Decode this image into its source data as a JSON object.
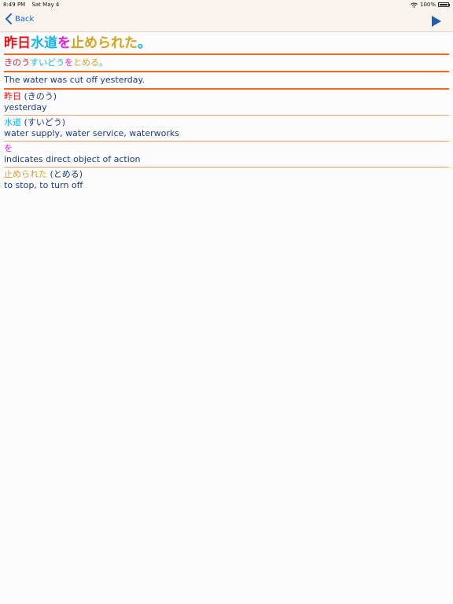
{
  "status_bar": {
    "time": "8:49 PM",
    "date": "Sat May 4",
    "battery": "100%"
  },
  "nav": {
    "back_label": "Back"
  },
  "colors": {
    "red": "#e8141c",
    "cyan": "#17b5e6",
    "magenta": "#e620e0",
    "gold": "#d6a21c",
    "blue": "#1a3b85",
    "orange": "#ef6a22"
  },
  "sentence": {
    "segments": [
      {
        "text": "昨日",
        "color": "#e8141c"
      },
      {
        "text": "水道",
        "color": "#17b5e6"
      },
      {
        "text": "を",
        "color": "#e620e0"
      },
      {
        "text": "止められた",
        "color": "#d6a21c"
      },
      {
        "text": "。",
        "color": "#17b5e6"
      }
    ]
  },
  "reading": {
    "segments": [
      {
        "text": "きのう",
        "color": "#e8141c"
      },
      {
        "text": "すいどう",
        "color": "#17b5e6"
      },
      {
        "text": "を",
        "color": "#e620e0"
      },
      {
        "text": "とめる",
        "color": "#d6a21c"
      },
      {
        "text": "。",
        "color": "#17b5e6"
      }
    ]
  },
  "translation": "The water was cut off yesterday.",
  "words": [
    {
      "term": "昨日",
      "reading": " (きのう)",
      "meaning": "yesterday",
      "color": "#e8141c"
    },
    {
      "term": "水道",
      "reading": " (すいどう)",
      "meaning": "water supply, water service, waterworks",
      "color": "#17b5e6"
    },
    {
      "term": "を",
      "reading": "",
      "meaning": "indicates direct object of action",
      "color": "#e620e0"
    },
    {
      "term": "止められた",
      "reading": " (とめる)",
      "meaning": "to stop, to turn off",
      "color": "#d6a21c"
    }
  ]
}
